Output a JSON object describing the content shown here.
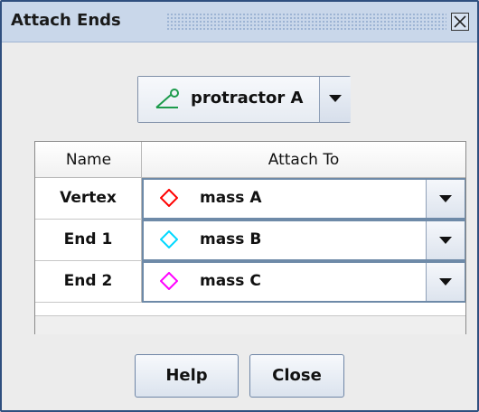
{
  "dialog": {
    "title": "Attach Ends"
  },
  "object_selector": {
    "icon": "protractor-icon",
    "label": "protractor A"
  },
  "table": {
    "headers": [
      "Name",
      "Attach To"
    ],
    "rows": [
      {
        "name": "Vertex",
        "attach_to": "mass A",
        "color": "#ff0000",
        "icon": "diamond-icon"
      },
      {
        "name": "End 1",
        "attach_to": "mass B",
        "color": "#00d8ff",
        "icon": "diamond-icon"
      },
      {
        "name": "End 2",
        "attach_to": "mass C",
        "color": "#ff00ff",
        "icon": "diamond-icon"
      }
    ]
  },
  "buttons": {
    "help": "Help",
    "close": "Close"
  }
}
